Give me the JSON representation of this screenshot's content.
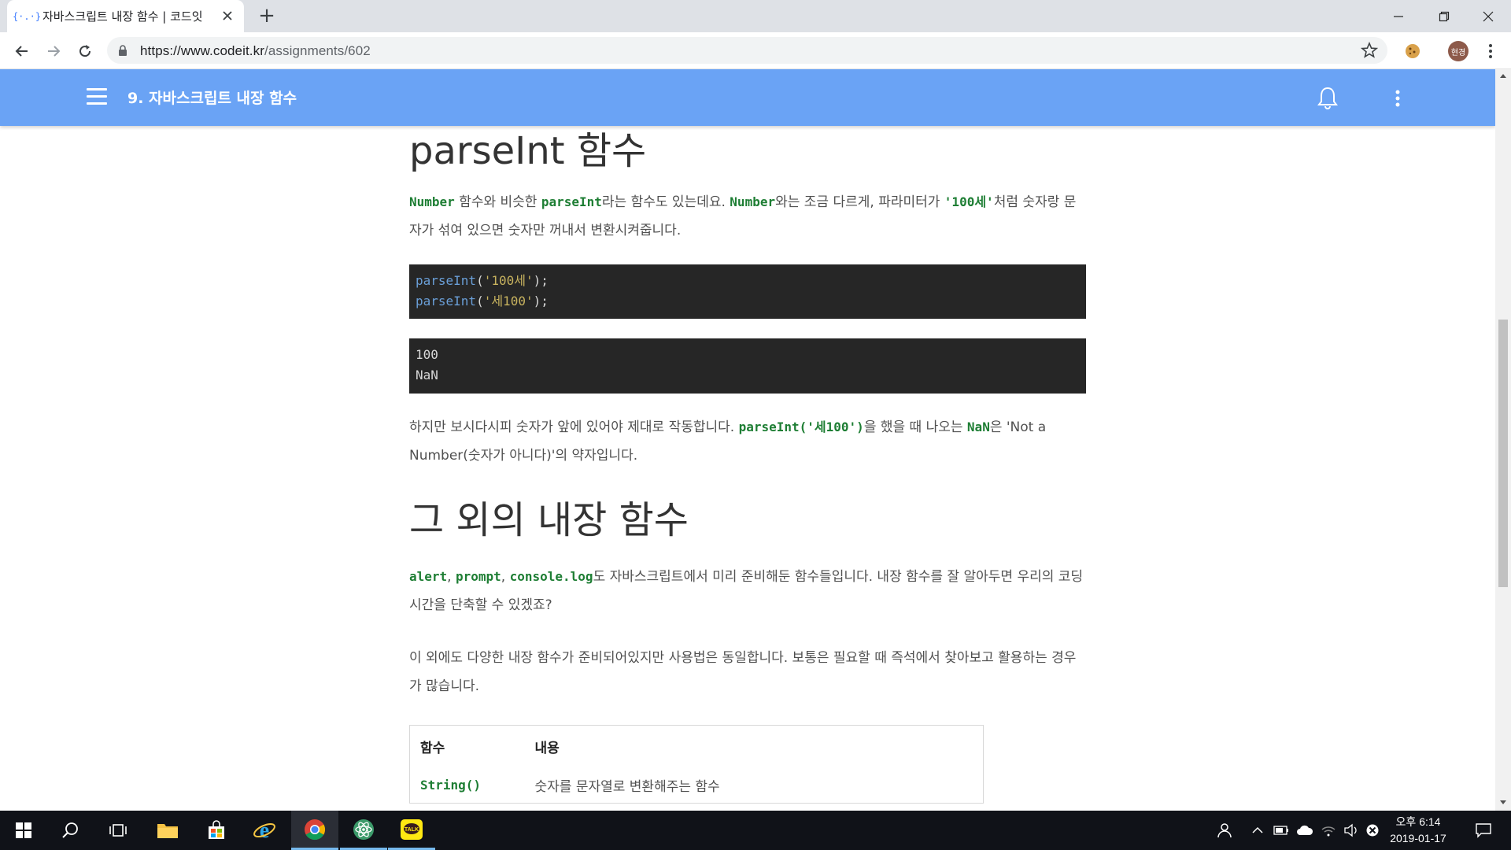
{
  "browser": {
    "tab_title": "자바스크립트 내장 함수 | 코드잇",
    "url_host": "https://www.codeit.kr",
    "url_path": "/assignments/602",
    "profile_initials": "현경"
  },
  "appbar": {
    "title": "9. 자바스크립트 내장 함수"
  },
  "article": {
    "h_parseint": "parseInt 함수",
    "p1": {
      "code_number": "Number",
      "t1": " 함수와 비슷한 ",
      "code_parseint": "parseInt",
      "t2": "라는 함수도 있는데요. ",
      "code_number2": "Number",
      "t3": "와는 조금 다르게, 파라미터가 ",
      "code_100se": "'100세'",
      "t4": "처럼 숫자랑 문자가 섞여 있으면 숫자만 꺼내서 변환시켜줍니다."
    },
    "code1": {
      "line1_fn": "parseInt",
      "line1_arg": "'100세'",
      "line1_end": ");",
      "line2_fn": "parseInt",
      "line2_arg": "'세100'",
      "line2_end": ");"
    },
    "output1": {
      "line1": "100",
      "line2": "NaN"
    },
    "p2": {
      "t1": "하지만 보시다시피 숫자가 앞에 있어야 제대로 작동합니다. ",
      "code_call": "parseInt('세100')",
      "t2": "을 했을 때 나오는 ",
      "code_nan": "NaN",
      "t3": "은 'Not a Number(숫자가 아니다)'의 약자입니다."
    },
    "h_others": "그 외의 내장 함수",
    "p3": {
      "code_alert": "alert",
      "sep1": ", ",
      "code_prompt": "prompt",
      "sep2": ", ",
      "code_log": "console.log",
      "t1": "도 자바스크립트에서 미리 준비해둔 함수들입니다. 내장 함수를 잘 알아두면 우리의 코딩 시간을 단축할 수 있겠죠?"
    },
    "p4": "이 외에도 다양한 내장 함수가 준비되어있지만 사용법은 동일합니다. 보통은 필요할 때 즉석에서 찾아보고 활용하는 경우가 많습니다.",
    "table": {
      "headers": [
        "함수",
        "내용"
      ],
      "rows": [
        [
          "String()",
          "숫자를 문자열로 변환해주는 함수"
        ]
      ]
    }
  },
  "taskbar": {
    "clock_time": "오후 6:14",
    "clock_date": "2019-01-17"
  },
  "colors": {
    "appbar": "#6aa3f5",
    "code_bg": "#262626",
    "inline_code": "#1e7e34"
  }
}
